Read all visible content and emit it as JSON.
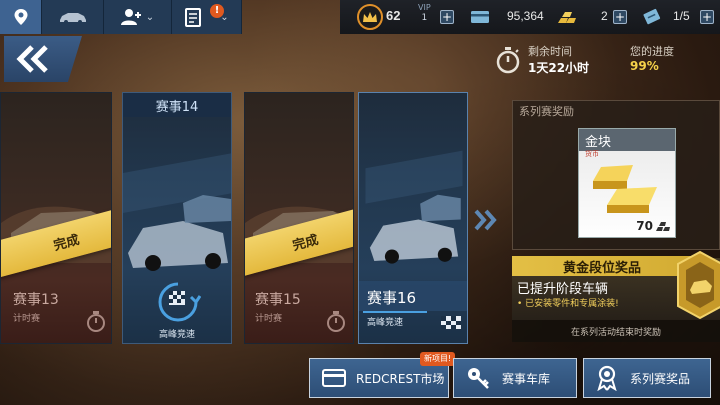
{
  "topbar": {
    "level": "62",
    "vip_label": "VIP",
    "vip_level": "1",
    "cash": "95,364",
    "gold": "2",
    "fuel": "1/5",
    "notification_badge": "!"
  },
  "progress": {
    "time_left_label": "剩余时间",
    "time_left_value": "1天22小时",
    "your_progress_label": "您的进度",
    "your_progress_value": "99%"
  },
  "events": [
    {
      "title": "赛事13",
      "subtitle": "计时赛",
      "status": "完成"
    },
    {
      "title": "赛事14",
      "subtitle": "高峰竞速"
    },
    {
      "title": "赛事15",
      "subtitle": "计时赛",
      "status": "完成"
    },
    {
      "title": "赛事16",
      "subtitle": "高峰竞速"
    }
  ],
  "reward": {
    "section_title": "系列赛奖励",
    "item_name": "金块",
    "item_type": "货币",
    "item_amount": "70",
    "tier_title": "黄金段位奖品",
    "tier_headline": "已提升阶段车辆",
    "tier_bullet": "• 已安装零件和专属涂装!",
    "footer": "在系列活动结束时奖励"
  },
  "buttons": {
    "market": "REDCREST市场",
    "market_badge": "新项目!",
    "garage": "赛事车库",
    "series_rewards": "系列赛奖品"
  },
  "colors": {
    "accent_blue": "#2d4e76",
    "gold": "#e3bf45",
    "progress_yellow": "#f5d24a",
    "notify_orange": "#e0591f"
  }
}
